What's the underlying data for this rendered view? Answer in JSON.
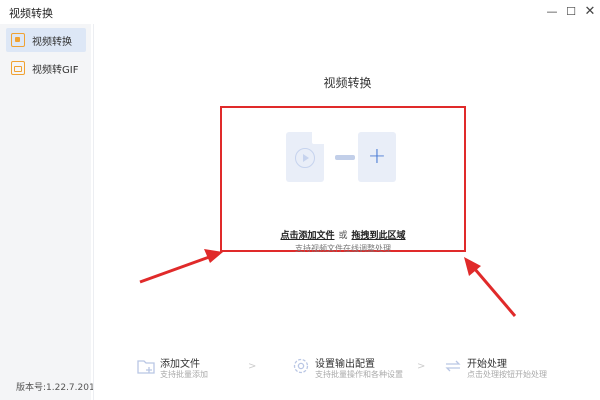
{
  "window": {
    "title": "视频转换",
    "controls": [
      "—",
      "☐",
      "✕"
    ]
  },
  "sidebar": {
    "items": [
      {
        "label": "视频转换",
        "icon": "video-convert-icon",
        "active": true
      },
      {
        "label": "视频转GIF",
        "icon": "gif-icon",
        "active": false
      }
    ],
    "version": "版本号:1.22.7.201"
  },
  "main": {
    "title": "视频转换",
    "dropzone": {
      "add_link": "点击添加文件",
      "or": "或",
      "drag_link": "拖拽到此区域",
      "hint": "支持视频文件在线调整处理",
      "plus": "+"
    },
    "steps": [
      {
        "title": "添加文件",
        "desc": "支持批量添加",
        "icon": "add-folder-icon"
      },
      {
        "title": "设置输出配置",
        "desc": "支持批量操作和各种设置",
        "icon": "settings-gear-icon"
      },
      {
        "title": "开始处理",
        "desc": "点击处理按钮开始处理",
        "icon": "process-icon"
      }
    ],
    "separators": [
      ">",
      ">"
    ]
  },
  "colors": {
    "accent": "#4a7bd4",
    "annotation": "#e02a2a",
    "sidebar_active": "#dde7f6",
    "icon_orange": "#f0a233"
  }
}
